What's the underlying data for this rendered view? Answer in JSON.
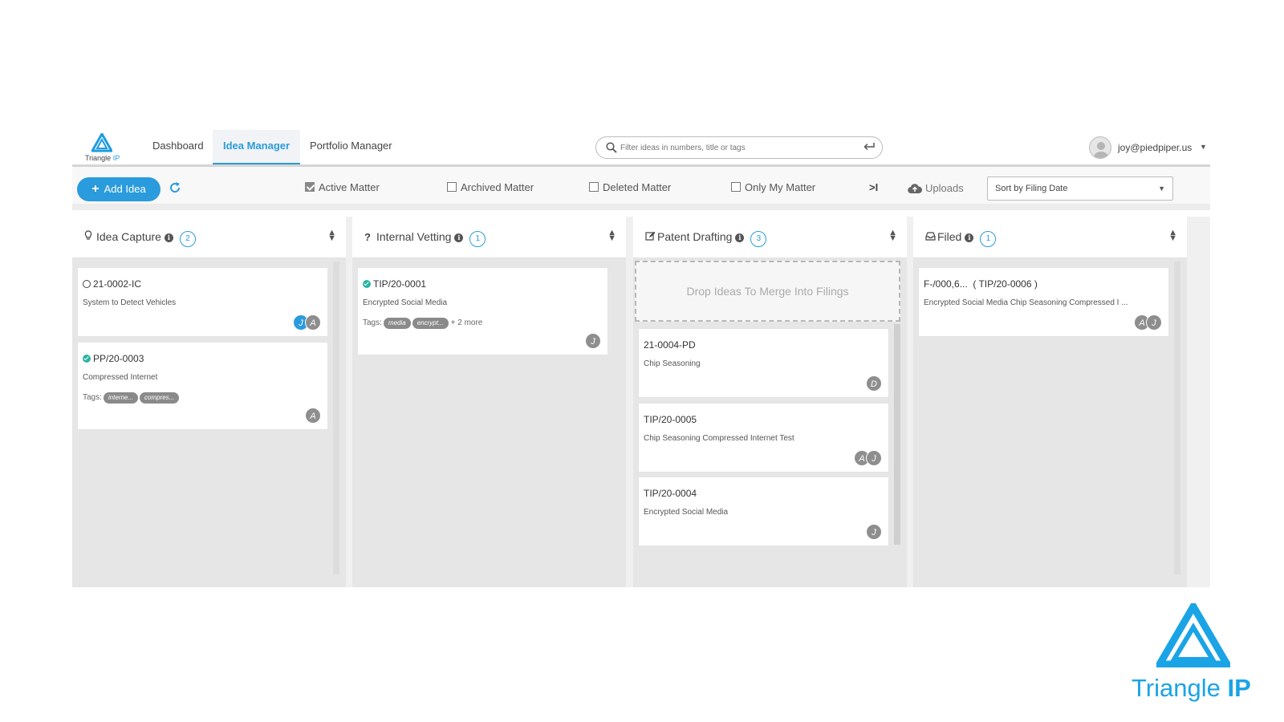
{
  "colors": {
    "accent": "#2a9bdc",
    "status_ok": "#2bb3a4",
    "avatar_gray": "#8e8e8e",
    "brand": "#1aa4e6"
  },
  "logo": {
    "text_main": "Triangle",
    "text_accent": "IP"
  },
  "nav": {
    "tabs": [
      {
        "label": "Dashboard",
        "active": false
      },
      {
        "label": "Idea Manager",
        "active": true
      },
      {
        "label": "Portfolio Manager",
        "active": false
      }
    ]
  },
  "search": {
    "placeholder": "Filter ideas in numbers, title or tags",
    "icon": "search-icon",
    "enter_icon": "enter-icon"
  },
  "user": {
    "email": "joy@piedpiper.us",
    "icon": "user-avatar-icon"
  },
  "toolbar": {
    "add_label": "Add Idea",
    "filters": [
      {
        "label": "Active Matter",
        "checked": true
      },
      {
        "label": "Archived Matter",
        "checked": false
      },
      {
        "label": "Deleted Matter",
        "checked": false
      },
      {
        "label": "Only My Matter",
        "checked": false
      }
    ],
    "skip_label": ">I",
    "uploads_label": "Uploads",
    "sort_value": "Sort by Filing Date"
  },
  "columns": [
    {
      "title": "Idea Capture",
      "icon": "lightbulb-icon",
      "count": "2",
      "cards": [
        {
          "id": "21-0002-IC",
          "status": "open",
          "title": "System to Detect Vehicles",
          "tags": [],
          "more": "",
          "avatars": [
            {
              "l": "J",
              "blue": true
            },
            {
              "l": "A",
              "blue": false
            }
          ]
        },
        {
          "id": "PP/20-0003",
          "status": "ok",
          "title": "Compressed Internet",
          "tags": [
            "interne...",
            "compres..."
          ],
          "more": "",
          "avatars": [
            {
              "l": "A",
              "blue": false
            }
          ]
        }
      ]
    },
    {
      "title": "Internal Vetting",
      "icon": "question-icon",
      "count": "1",
      "cards": [
        {
          "id": "TIP/20-0001",
          "status": "ok",
          "title": "Encrypted Social Media",
          "tags": [
            "media",
            "encrypt..."
          ],
          "more": "+ 2 more",
          "avatars": [
            {
              "l": "J",
              "blue": false
            }
          ]
        }
      ]
    },
    {
      "title": "Patent Drafting",
      "icon": "edit-icon",
      "count": "3",
      "dropzone": "Drop Ideas To Merge Into Filings",
      "cards": [
        {
          "id": "21-0004-PD",
          "status": "none",
          "title": "Chip Seasoning",
          "tags": [],
          "more": "",
          "avatars": [
            {
              "l": "D",
              "blue": false
            }
          ]
        },
        {
          "id": "TIP/20-0005",
          "status": "none",
          "title": "Chip Seasoning Compressed Internet Test",
          "tags": [],
          "more": "",
          "avatars": [
            {
              "l": "A",
              "blue": false
            },
            {
              "l": "J",
              "blue": false
            }
          ]
        },
        {
          "id": "TIP/20-0004",
          "status": "none",
          "title": "Encrypted Social Media",
          "tags": [],
          "more": "",
          "avatars": [
            {
              "l": "J",
              "blue": false
            }
          ]
        }
      ]
    },
    {
      "title": "Filed",
      "icon": "inbox-icon",
      "count": "1",
      "cards": [
        {
          "id": "F-/000,6...  ( TIP/20-0006 )",
          "status": "none",
          "title": "Encrypted Social Media Chip Seasoning Compressed I ...",
          "tags": [],
          "more": "",
          "avatars": [
            {
              "l": "A",
              "blue": false
            },
            {
              "l": "J",
              "blue": false
            }
          ]
        }
      ]
    }
  ],
  "tags_label": "Tags:",
  "brand": {
    "text_main": "Triangle",
    "text_accent": "IP"
  }
}
